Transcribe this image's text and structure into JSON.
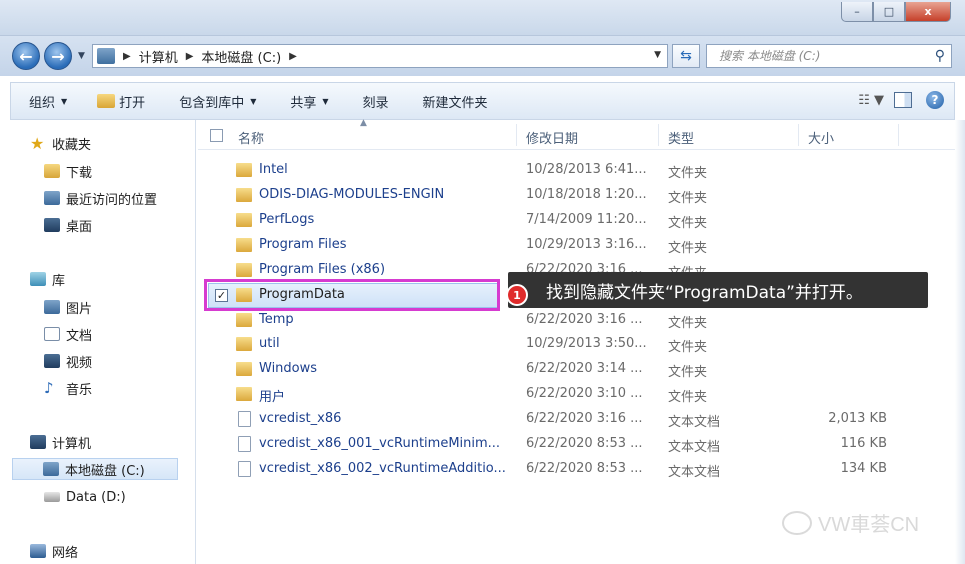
{
  "window": {
    "minimize": "–",
    "maximize": "□",
    "close": "x"
  },
  "address": {
    "back": "←",
    "forward": "→",
    "breadcrumbs": [
      "计算机",
      "本地磁盘 (C:)"
    ],
    "search_placeholder": "搜索 本地磁盘 (C:)"
  },
  "toolbar": {
    "organize": "组织",
    "open": "打开",
    "include": "包含到库中",
    "share": "共享",
    "burn": "刻录",
    "new_folder": "新建文件夹"
  },
  "nav": {
    "favorites": "收藏夹",
    "downloads": "下载",
    "recent": "最近访问的位置",
    "desktop": "桌面",
    "libraries": "库",
    "pictures": "图片",
    "documents": "文档",
    "videos": "视频",
    "music": "音乐",
    "computer": "计算机",
    "drive_c": "本地磁盘 (C:)",
    "drive_d": "Data (D:)",
    "network": "网络"
  },
  "columns": {
    "name": "名称",
    "date": "修改日期",
    "type": "类型",
    "size": "大小"
  },
  "files": [
    {
      "name": "Intel",
      "date": "10/28/2013 6:41...",
      "type": "文件夹",
      "size": "",
      "kind": "folder"
    },
    {
      "name": "ODIS-DIAG-MODULES-ENGIN",
      "date": "10/18/2018 1:20...",
      "type": "文件夹",
      "size": "",
      "kind": "folder"
    },
    {
      "name": "PerfLogs",
      "date": "7/14/2009 11:20...",
      "type": "文件夹",
      "size": "",
      "kind": "folder"
    },
    {
      "name": "Program Files",
      "date": "10/29/2013 3:16...",
      "type": "文件夹",
      "size": "",
      "kind": "folder"
    },
    {
      "name": "Program Files (x86)",
      "date": "6/22/2020 3:16 ...",
      "type": "文件夹",
      "size": "",
      "kind": "folder"
    },
    {
      "name": "ProgramData",
      "date": "",
      "type": "",
      "size": "",
      "kind": "folder",
      "selected": true
    },
    {
      "name": "Temp",
      "date": "6/22/2020 3:16 ...",
      "type": "文件夹",
      "size": "",
      "kind": "folder"
    },
    {
      "name": "util",
      "date": "10/29/2013 3:50...",
      "type": "文件夹",
      "size": "",
      "kind": "folder"
    },
    {
      "name": "Windows",
      "date": "6/22/2020 3:14 ...",
      "type": "文件夹",
      "size": "",
      "kind": "folder"
    },
    {
      "name": "用户",
      "date": "6/22/2020 3:10 ...",
      "type": "文件夹",
      "size": "",
      "kind": "folder"
    },
    {
      "name": "vcredist_x86",
      "date": "6/22/2020 3:16 ...",
      "type": "文本文档",
      "size": "2,013 KB",
      "kind": "text"
    },
    {
      "name": "vcredist_x86_001_vcRuntimeMinim...",
      "date": "6/22/2020 8:53 ...",
      "type": "文本文档",
      "size": "116 KB",
      "kind": "text"
    },
    {
      "name": "vcredist_x86_002_vcRuntimeAdditio...",
      "date": "6/22/2020 8:53 ...",
      "type": "文本文档",
      "size": "134 KB",
      "kind": "text"
    }
  ],
  "annotation": {
    "step": "1",
    "text": "找到隐藏文件夹“ProgramData”并打开。",
    "highlight_color": "#d63bd0",
    "badge_color": "#e02b2b"
  },
  "watermark": "VW車荟CN"
}
